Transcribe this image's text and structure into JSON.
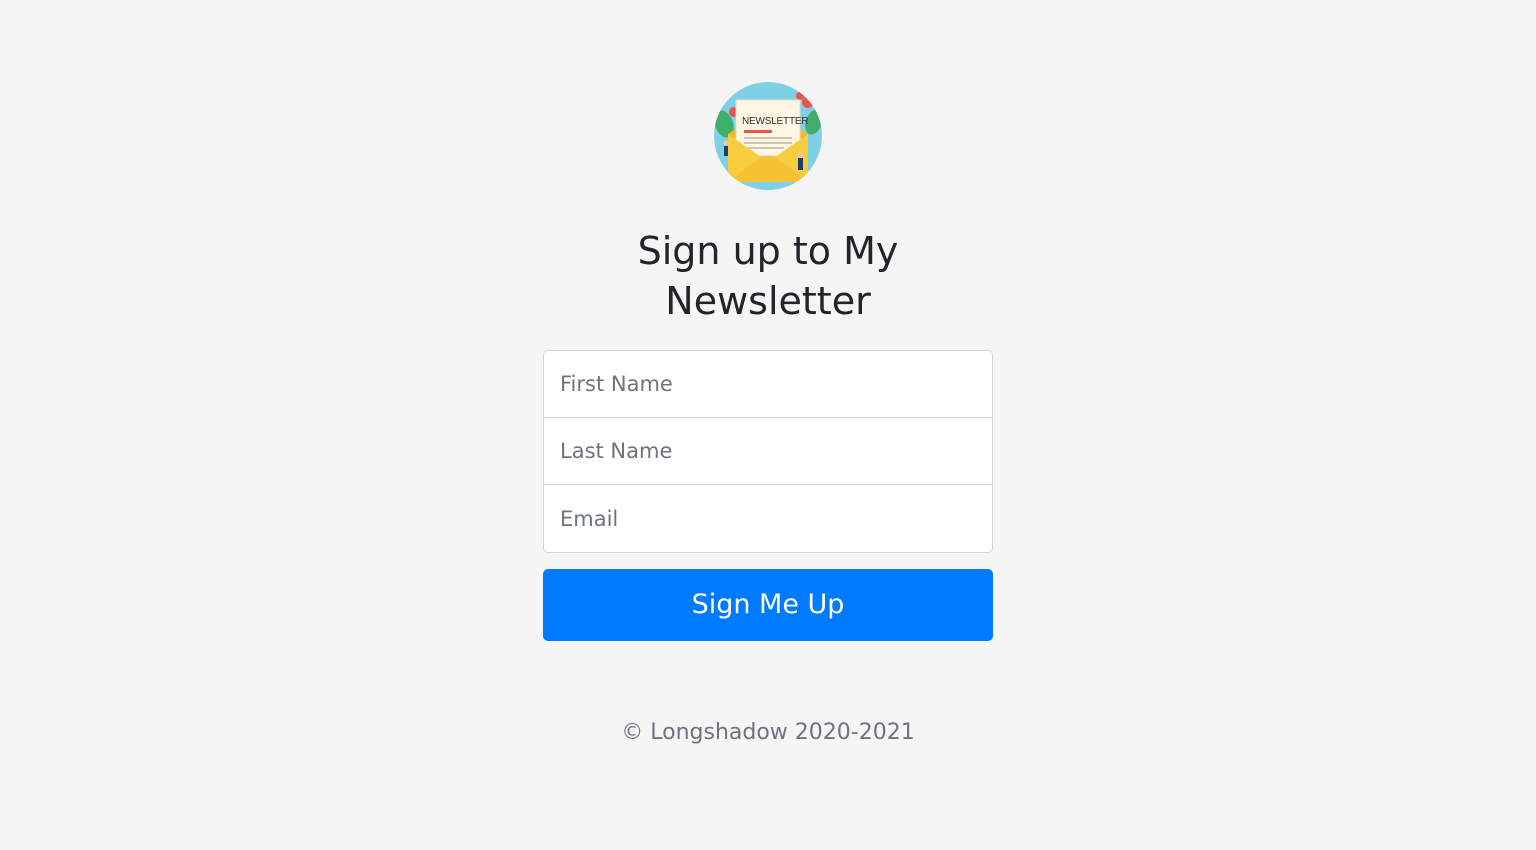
{
  "logo": {
    "icon": "newsletter-envelope-icon",
    "text": "NEWSLETTER"
  },
  "heading": {
    "line1": "Sign up to My",
    "line2": "Newsletter"
  },
  "form": {
    "first_name": {
      "placeholder": "First Name",
      "value": ""
    },
    "last_name": {
      "placeholder": "Last Name",
      "value": ""
    },
    "email": {
      "placeholder": "Email",
      "value": ""
    },
    "submit_label": "Sign Me Up"
  },
  "footer": {
    "copyright": "© Longshadow 2020-2021"
  },
  "colors": {
    "background": "#f5f5f5",
    "primary": "#007bff",
    "text": "#212529",
    "muted": "#6c757d"
  }
}
